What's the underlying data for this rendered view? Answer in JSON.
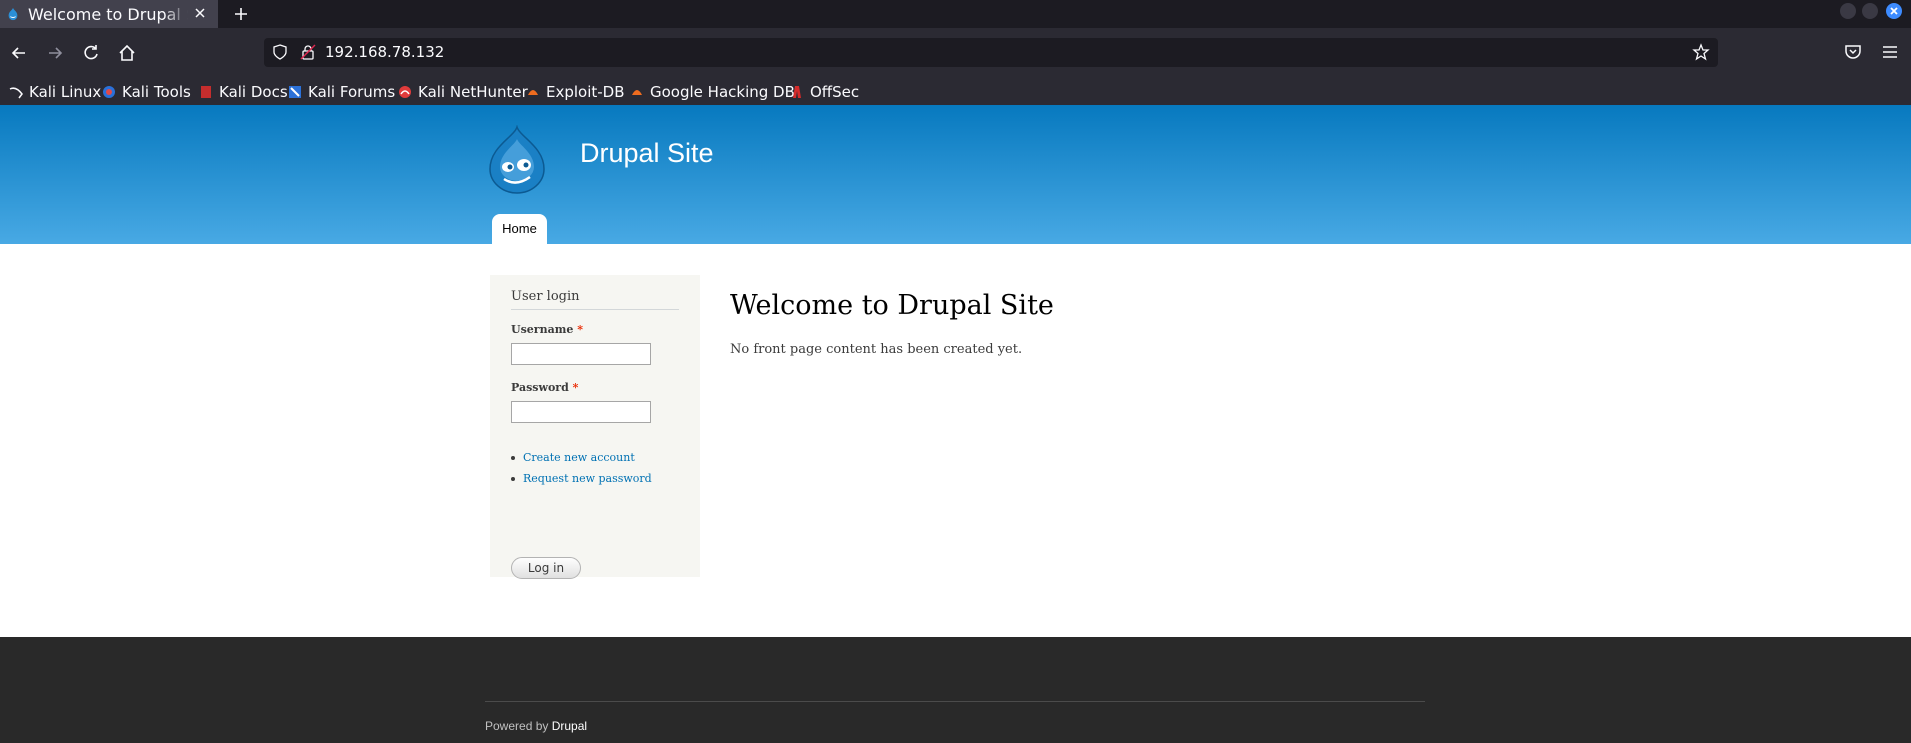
{
  "browser": {
    "tab_title": "Welcome to Drupal Site | D",
    "url": "192.168.78.132",
    "bookmarks": [
      {
        "label": "Kali Linux",
        "icon": "kali-linux-icon"
      },
      {
        "label": "Kali Tools",
        "icon": "kali-tools-icon"
      },
      {
        "label": "Kali Docs",
        "icon": "kali-docs-icon"
      },
      {
        "label": "Kali Forums",
        "icon": "kali-forums-icon"
      },
      {
        "label": "Kali NetHunter",
        "icon": "kali-nethunter-icon"
      },
      {
        "label": "Exploit-DB",
        "icon": "exploit-db-icon"
      },
      {
        "label": "Google Hacking DB",
        "icon": "google-hacking-db-icon"
      },
      {
        "label": "OffSec",
        "icon": "offsec-icon"
      }
    ]
  },
  "site": {
    "name": "Drupal Site",
    "nav": {
      "home": "Home"
    }
  },
  "login": {
    "title": "User login",
    "username_label": "Username",
    "password_label": "Password",
    "required_mark": "*",
    "username_value": "",
    "password_value": "",
    "links": {
      "create_account": "Create new account",
      "request_password": "Request new password"
    },
    "submit": "Log in"
  },
  "main": {
    "title": "Welcome to Drupal Site",
    "body": "No front page content has been created yet."
  },
  "footer": {
    "powered_prefix": "Powered by",
    "powered_link": "Drupal"
  },
  "colors": {
    "header_top": "#0779bf",
    "header_bottom": "#48a9e4",
    "link": "#0071b3",
    "footer_bg": "#292929"
  }
}
